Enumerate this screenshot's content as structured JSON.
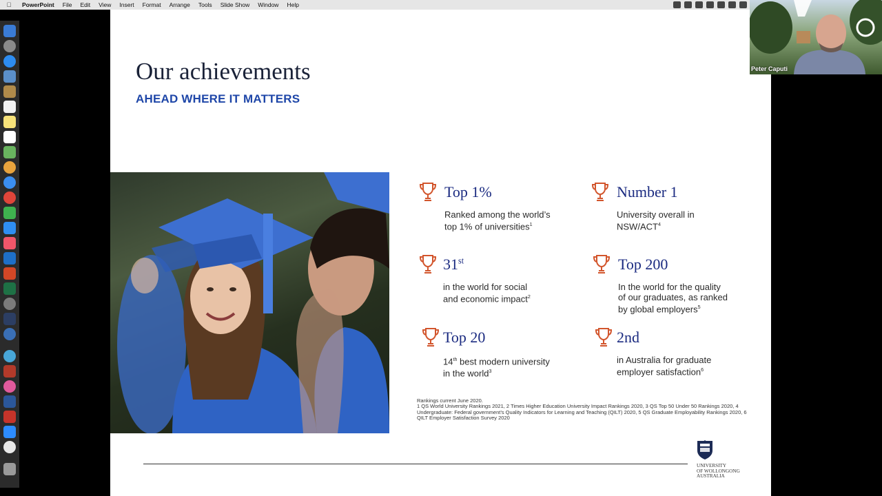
{
  "menubar": {
    "app_name": "PowerPoint",
    "items": [
      "File",
      "Edit",
      "View",
      "Insert",
      "Format",
      "Arrange",
      "Tools",
      "Slide Show",
      "Window",
      "Help"
    ]
  },
  "slide": {
    "title": "Our achievements",
    "subtitle": "AHEAD WHERE IT MATTERS",
    "achievements": [
      {
        "heading": "Top 1%",
        "desc_line1": "Ranked among the world’s",
        "desc_line2": "top 1% of universities",
        "desc_note": "1"
      },
      {
        "heading": "Number 1",
        "desc_line1": "University overall in",
        "desc_line2": "NSW/ACT",
        "desc_note": "4"
      },
      {
        "heading": "31",
        "heading_sup": "st",
        "desc_line1": "in the world for social",
        "desc_line2": "and economic impact",
        "desc_note": "2"
      },
      {
        "heading": "Top 200",
        "desc_line1": "In the world for the quality",
        "desc_line2": "of our graduates, as ranked",
        "desc_line3": "by global employers",
        "desc_note": "5"
      },
      {
        "heading": "Top 20",
        "desc_pre": "14",
        "desc_pre_sup": "th",
        "desc_line1": " best modern university",
        "desc_line2": "in the world",
        "desc_note": "3"
      },
      {
        "heading": "2nd",
        "desc_line1": "in Australia for graduate",
        "desc_line2": "employer satisfaction",
        "desc_note": "6"
      }
    ],
    "footnote": {
      "line1": "Rankings current June 2020.",
      "line2": "1 QS World University Rankings 2021, 2 Times Higher Education University Impact Rankings 2020, 3 QS Top 50 Under 50 Rankings 2020, 4 Undergraduate: Federal government’s Quality Indicators for Learning and Teaching (QILT) 2020, 5 QS Graduate Employability Rankings 2020, 6 QILT Employer Satisfaction Survey 2020"
    },
    "logo": {
      "line1": "UNIVERSITY",
      "line2": "OF WOLLONGONG",
      "line3": "AUSTRALIA"
    }
  },
  "webcam": {
    "name": "Peter Caputi"
  },
  "colors": {
    "accent_blue": "#1e46a8",
    "heading_navy": "#1a2a80",
    "trophy_orange": "#d2552c"
  }
}
